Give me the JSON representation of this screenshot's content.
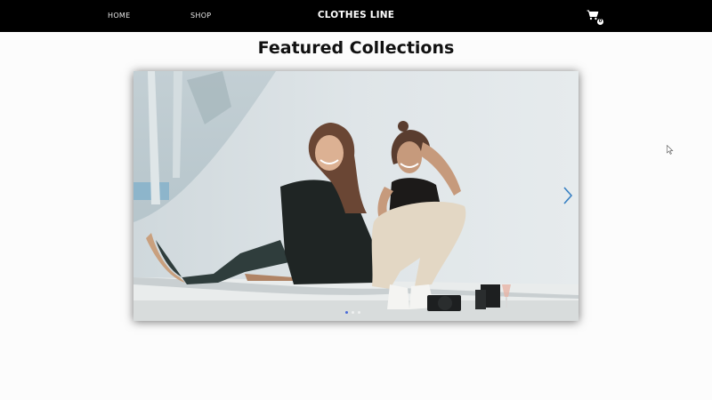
{
  "nav": {
    "home_label": "HOME",
    "shop_label": "SHOP",
    "brand": "CLOTHES LINE",
    "cart_count": "0",
    "cart_icon": "shopping-cart-icon"
  },
  "main": {
    "title": "Featured Collections"
  },
  "carousel": {
    "slide_image": "photo of two women laughing, seated on a white ledge",
    "next_icon": "chevron-right-icon",
    "slide_count": 3,
    "active_slide": 1
  },
  "colors": {
    "navbar_bg": "#000000",
    "nav_text": "#ffffff",
    "page_bg": "#fcfcfc",
    "arrow": "#3b82c4",
    "active_dot": "#4a6bd8"
  }
}
